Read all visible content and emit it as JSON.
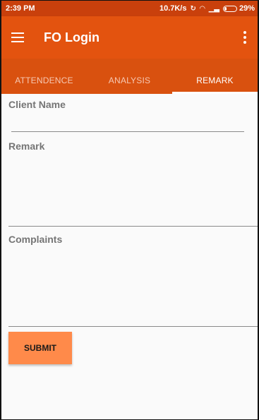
{
  "status_bar": {
    "time": "2:39 PM",
    "speed": "10.7K/s",
    "battery_percent": "29%",
    "battery_level": 0.29
  },
  "app_bar": {
    "title": "FO Login",
    "menu_icon": "hamburger-menu-icon",
    "overflow_icon": "more-vert-icon"
  },
  "tabs": [
    {
      "label": "ATTENDENCE",
      "active": false
    },
    {
      "label": "ANALYSIS",
      "active": false
    },
    {
      "label": "REMARK",
      "active": true
    }
  ],
  "form": {
    "client_name_label": "Client Name",
    "client_name_value": "",
    "remark_label": "Remark",
    "remark_value": "",
    "complaints_label": "Complaints",
    "complaints_value": "",
    "submit_label": "SUBMIT"
  },
  "colors": {
    "status_bar": "#c9400c",
    "app_bar": "#e3530f",
    "tab_bar": "#d9510f",
    "submit_button": "#ff8a4a"
  }
}
